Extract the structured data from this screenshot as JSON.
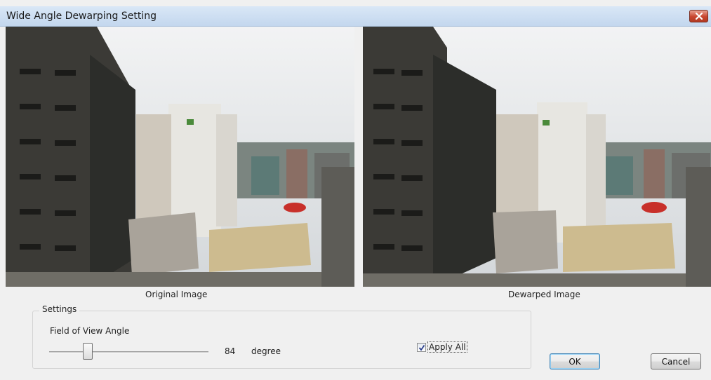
{
  "window": {
    "title": "Wide Angle Dewarping Setting"
  },
  "preview": {
    "original_caption": "Original Image",
    "dewarped_caption": "Dewarped Image"
  },
  "settings": {
    "group_label": "Settings",
    "fov_label": "Field of View Angle",
    "fov_value": "84",
    "fov_unit": "degree",
    "apply_all_label": "Apply All",
    "apply_all_checked": true
  },
  "buttons": {
    "ok_label": "OK",
    "cancel_label": "Cancel"
  },
  "icons": {
    "close": "close-icon",
    "check": "checkmark-icon"
  },
  "colors": {
    "title_bar": "#c3d7ee",
    "close_button": "#c8452e",
    "ok_button_border": "#3c7fb1"
  }
}
